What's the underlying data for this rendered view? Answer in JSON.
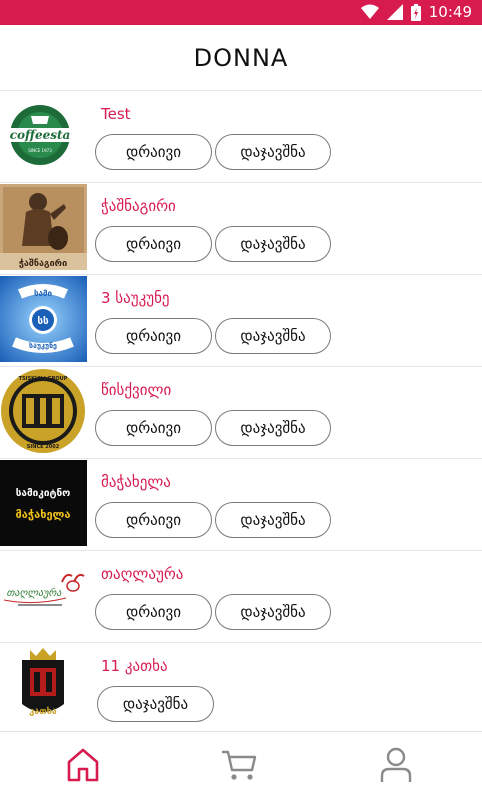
{
  "status_bar": {
    "time": "10:49",
    "background": "#d81b4f"
  },
  "header": {
    "title": "DONNA"
  },
  "actions": {
    "driver_label": "დრაივი",
    "book_label": "დაჯავშნა"
  },
  "restaurants": [
    {
      "name": "Test",
      "logo_text": "coffeesta",
      "logo_sub": "SINCE 1973",
      "has_driver": true
    },
    {
      "name": "ჭაშნაგირი",
      "logo_text": "ჭაშნაგირი",
      "has_driver": true
    },
    {
      "name": "3 საუკუნე",
      "logo_text": "სამი საუკუნე",
      "has_driver": true
    },
    {
      "name": "წისქვილი",
      "logo_text": "TSISKVILI GROUP",
      "logo_sub": "SINCE 2002",
      "has_driver": true
    },
    {
      "name": "მაჭახელა",
      "logo_text": "სამიკიტნო",
      "logo_sub": "მაჭახელა",
      "has_driver": true
    },
    {
      "name": "თაღლაურა",
      "logo_text": "თაღლაურა",
      "has_driver": true
    },
    {
      "name": "11 კათხა",
      "logo_text": "კათხა",
      "has_driver": false
    }
  ],
  "bottom_nav": [
    {
      "icon": "home-icon",
      "active": true
    },
    {
      "icon": "cart-icon",
      "active": false
    },
    {
      "icon": "profile-icon",
      "active": false
    }
  ],
  "colors": {
    "accent": "#d81b4f",
    "border": "#e6e6e6",
    "inactive_icon": "#8a8a8a"
  }
}
